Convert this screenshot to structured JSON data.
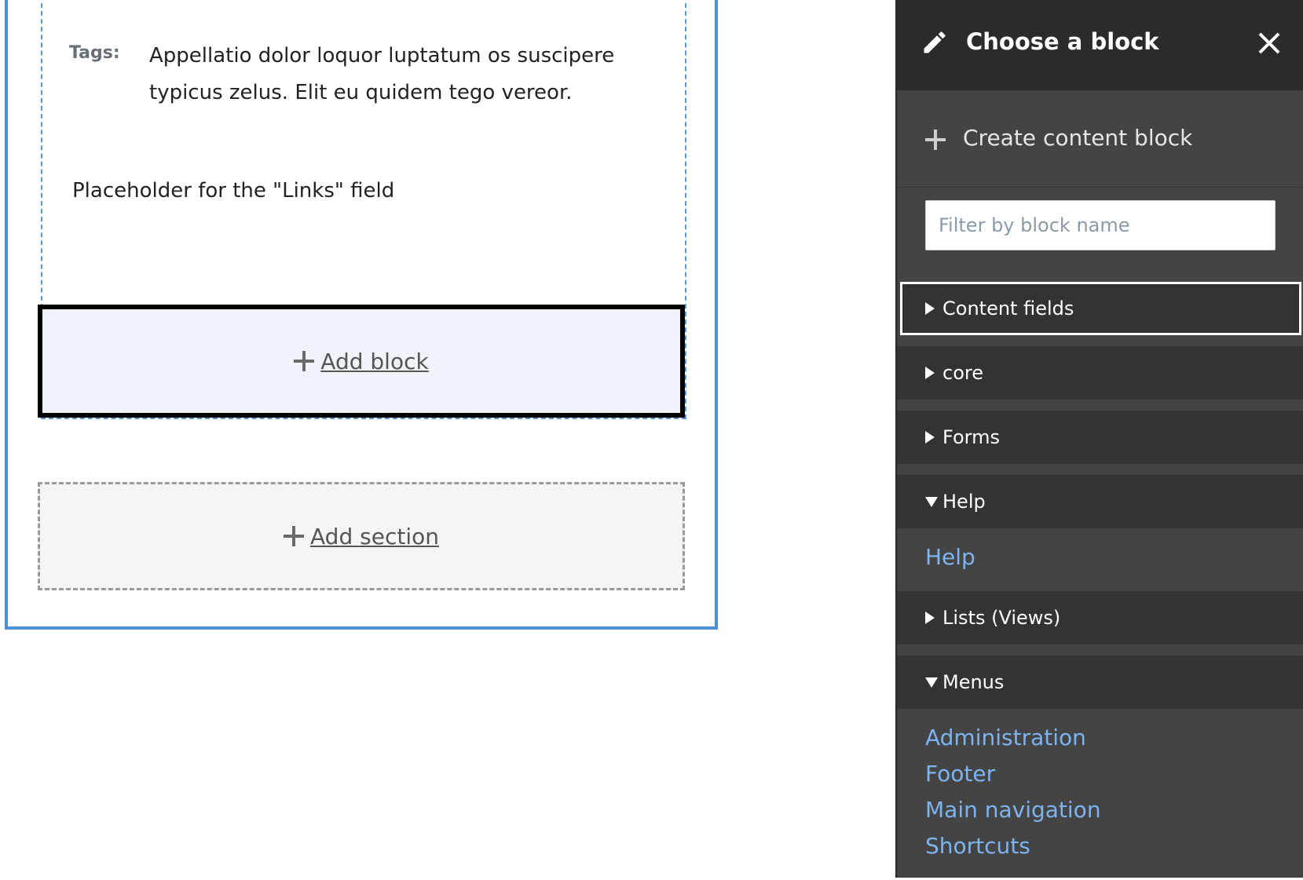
{
  "canvas": {
    "tags_label": "Tags:",
    "tags_value": "Appellatio dolor loquor luptatum os suscipere typicus zelus. Elit eu quidem tego vereor.",
    "links_placeholder": "Placeholder for the \"Links\" field",
    "add_block_label": "Add block",
    "add_section_label": "Add section"
  },
  "sidebar": {
    "title": "Choose a block",
    "create_label": "Create content block",
    "filter_placeholder": "Filter by block name",
    "groups": [
      {
        "label": "Content fields",
        "expanded": false,
        "links": []
      },
      {
        "label": "core",
        "expanded": false,
        "links": []
      },
      {
        "label": "Forms",
        "expanded": false,
        "links": []
      },
      {
        "label": "Help",
        "expanded": true,
        "links": [
          "Help"
        ]
      },
      {
        "label": "Lists (Views)",
        "expanded": false,
        "links": []
      },
      {
        "label": "Menus",
        "expanded": true,
        "links": [
          "Administration",
          "Footer",
          "Main navigation",
          "Shortcuts"
        ]
      }
    ]
  },
  "colors": {
    "section_border": "#4a8fd7",
    "sidebar_bg": "#444444",
    "sidebar_header_bg": "#2b2b2b",
    "link_color": "#7cb4f2"
  }
}
